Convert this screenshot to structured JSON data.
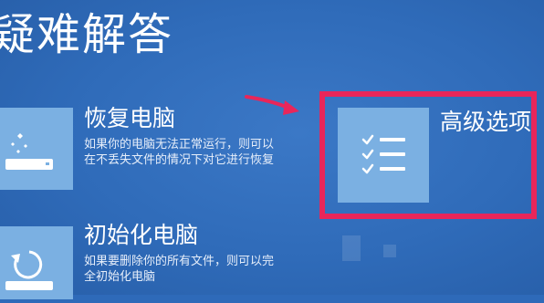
{
  "page": {
    "title": "疑难解答"
  },
  "options": [
    {
      "title": "恢复电脑",
      "desc_lines": [
        "如果你的电脑无法正常运行，则可以",
        "在不丢失文件的情况下对它进行恢复"
      ],
      "icon": "refresh-pc-icon"
    },
    {
      "title": "初始化电脑",
      "desc_lines": [
        "如果要删除你的所有文件，则可以完",
        "全初始化电脑"
      ],
      "icon": "reset-pc-icon"
    },
    {
      "title": "高级选项",
      "icon": "advanced-options-checklist-icon",
      "highlighted": true
    }
  ],
  "colors": {
    "background": "#2e6ab9",
    "tile": "#7bb0e2",
    "highlight": "#e8265a"
  }
}
